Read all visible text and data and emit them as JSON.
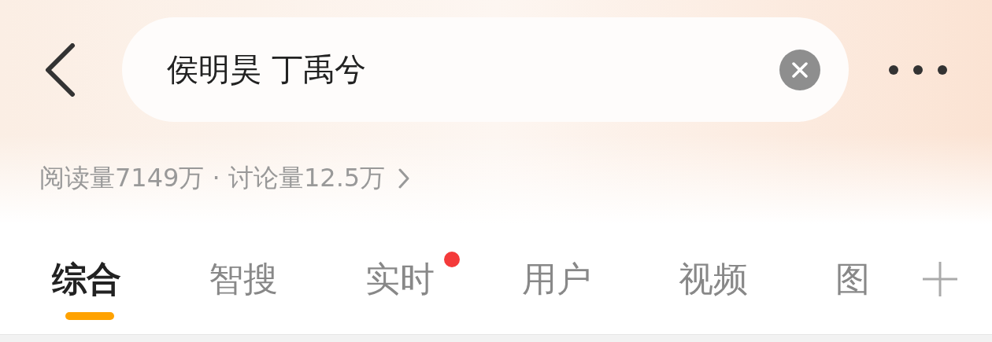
{
  "search": {
    "value": "侯明昊 丁禹兮"
  },
  "stats": {
    "text": "阅读量7149万 · 讨论量12.5万"
  },
  "tabs": [
    {
      "label": "综合",
      "selected": true,
      "badge": false
    },
    {
      "label": "智搜",
      "selected": false,
      "badge": false
    },
    {
      "label": "实时",
      "selected": false,
      "badge": true
    },
    {
      "label": "用户",
      "selected": false,
      "badge": false
    },
    {
      "label": "视频",
      "selected": false,
      "badge": false
    },
    {
      "label": "图",
      "selected": false,
      "badge": false
    }
  ]
}
